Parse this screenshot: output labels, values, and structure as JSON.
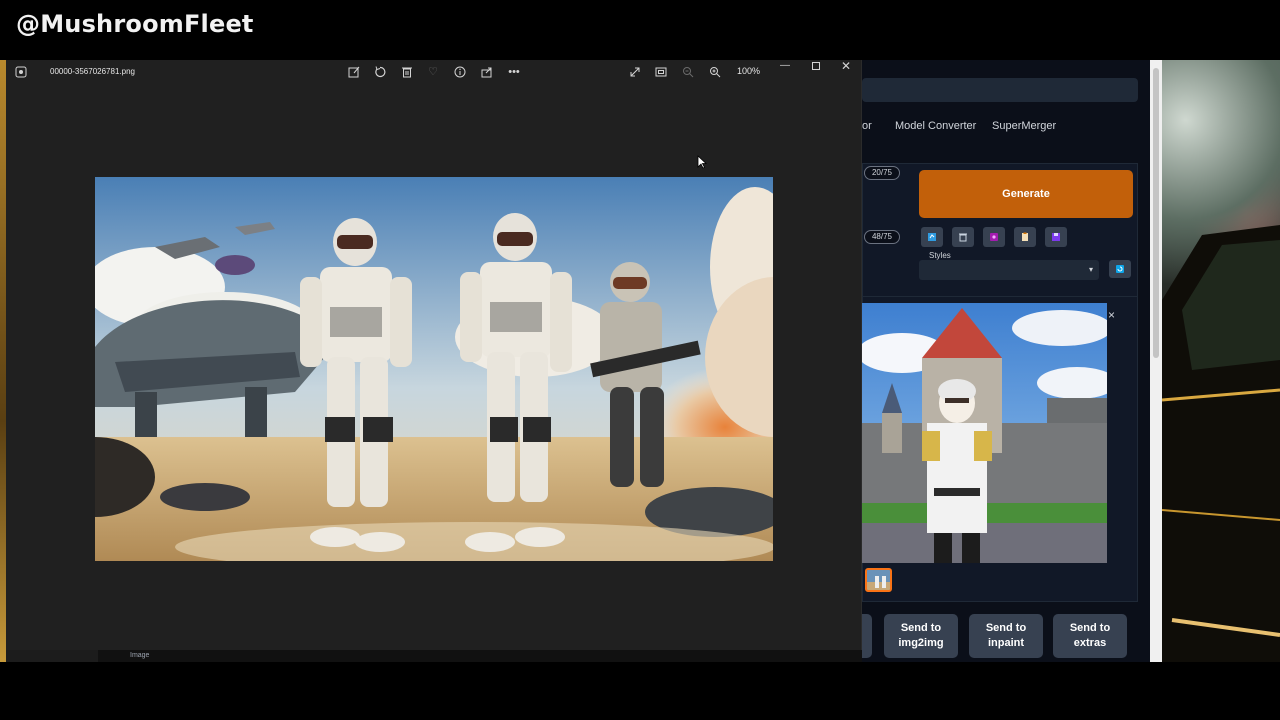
{
  "watermark": "@MushroomFleet",
  "viewer": {
    "filename": "00000-3567026781.png",
    "toolbar_icons": [
      "edit-icon",
      "rotate-icon",
      "delete-icon",
      "favorite-icon",
      "info-icon",
      "share-icon",
      "more-icon"
    ],
    "view_icons": [
      "expand-icon",
      "fit-window-icon",
      "zoom-out-icon",
      "zoom-in-icon"
    ],
    "zoom_level": "100%",
    "window_controls": [
      "minimize",
      "maximize",
      "close"
    ]
  },
  "webui": {
    "tabs": [
      "or",
      "Model Converter",
      "SuperMerger"
    ],
    "prompt_counter": "20/75",
    "negative_counter": "48/75",
    "generate_label": "Generate",
    "tool_buttons": [
      "paste-icon",
      "trash-icon",
      "extra-networks-icon",
      "clipboard-icon",
      "save-style-icon"
    ],
    "styles_label": "Styles",
    "styles_value": "",
    "close_label": "×",
    "send_buttons": [
      {
        "line1": "Send to",
        "line2": "img2img"
      },
      {
        "line1": "Send to",
        "line2": "inpaint"
      },
      {
        "line1": "Send to",
        "line2": "extras"
      }
    ],
    "accent_color": "#c2600a"
  },
  "underlying": {
    "tab_label": "Image"
  }
}
